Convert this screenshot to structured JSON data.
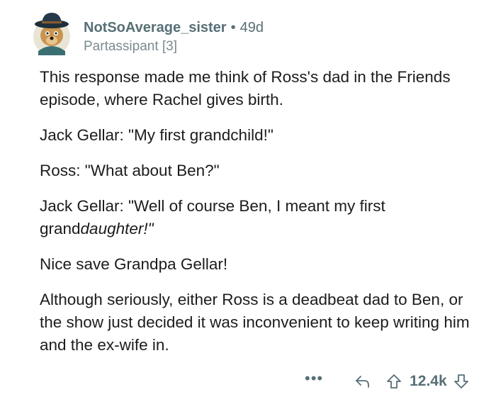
{
  "comment": {
    "username": "NotSoAverage_sister",
    "separator": "•",
    "age": "49d",
    "flair": "Partassipant [3]",
    "paragraphs": {
      "p1": "This response made me think of Ross's dad in the Friends episode, where Rachel gives birth.",
      "p2": "Jack Gellar: \"My first grandchild!\"",
      "p3": "Ross: \"What about Ben?\"",
      "p4_plain": "Jack Gellar: \"Well of course Ben, I meant my first grand",
      "p4_italic": "daughter!\"",
      "p5": "Nice save Grandpa Gellar!",
      "p6": "Although seriously, either Ross is a deadbeat dad to Ben, or the show just decided it was inconvenient to keep writing him and the ex-wife in."
    }
  },
  "actions": {
    "more": "•••",
    "score": "12.4k"
  },
  "icons": {
    "avatar": "avatar-icon",
    "reply": "reply-icon",
    "upvote": "upvote-icon",
    "downvote": "downvote-icon"
  },
  "colors": {
    "text": "#1c1c1c",
    "meta": "#576f76",
    "flair": "#7c8a8f"
  }
}
